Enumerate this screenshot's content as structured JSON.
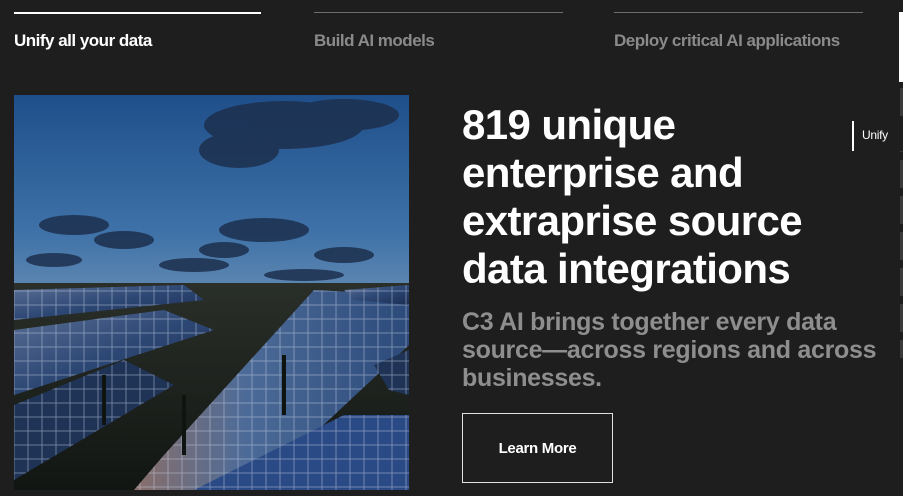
{
  "tabs": [
    {
      "label": "Unify all your data",
      "active": true
    },
    {
      "label": "Build AI models",
      "active": false
    },
    {
      "label": "Deploy critical AI applications",
      "active": false
    }
  ],
  "side_nav": {
    "label": "Unify"
  },
  "hero": {
    "headline": "819 unique enterprise and extraprise source data integrations",
    "description": "C3 AI brings together every data source—across regions and across businesses.",
    "cta_label": "Learn More"
  },
  "colors": {
    "background": "#1e1e1e",
    "text_primary": "#ffffff",
    "text_muted": "#8e8e8e",
    "button_border": "#e0e0e0"
  }
}
